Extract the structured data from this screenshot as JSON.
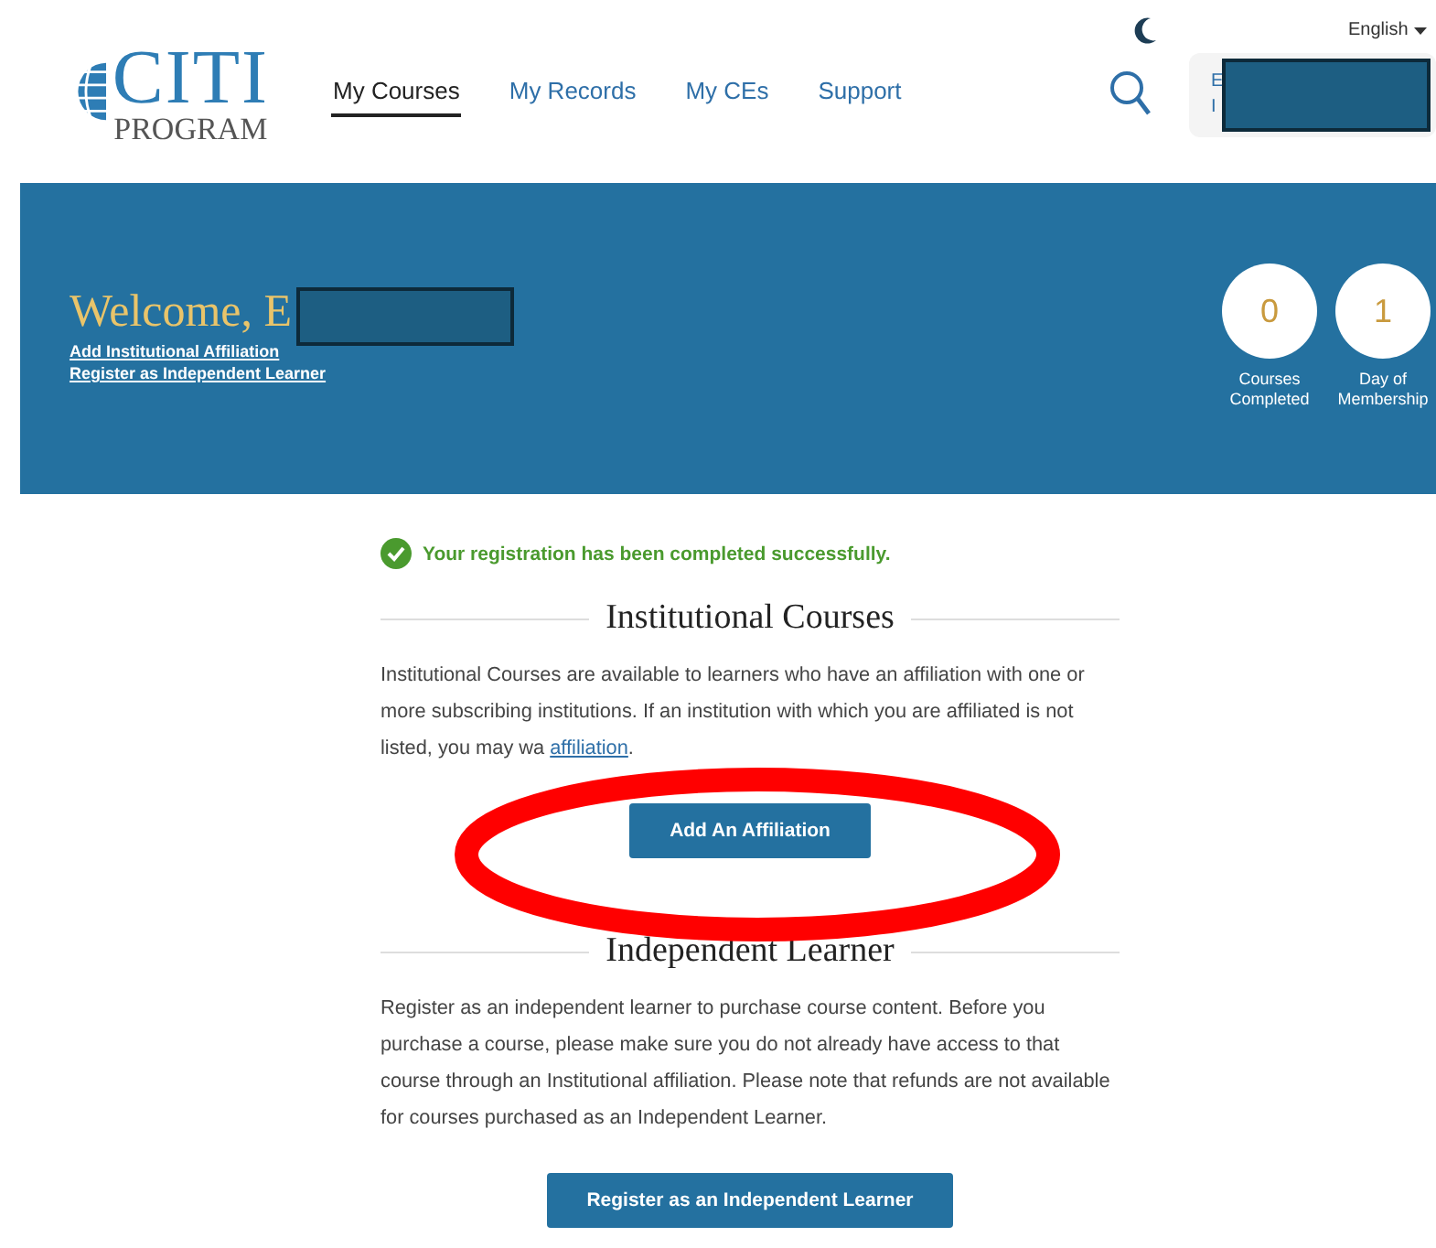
{
  "logo": {
    "title": "CITI",
    "subtitle": "PROGRAM"
  },
  "nav": [
    {
      "label": "My Courses",
      "selected": true
    },
    {
      "label": "My Records",
      "selected": false
    },
    {
      "label": "My CEs",
      "selected": false
    },
    {
      "label": "Support",
      "selected": false
    }
  ],
  "language": "English",
  "account": {
    "line_1": "E",
    "line_2": "I"
  },
  "banner": {
    "welcome": "Welcome, E",
    "links": [
      "Add Institutional Affiliation",
      "Register as Independent Learner"
    ],
    "stats": [
      {
        "value": "0",
        "label": "Courses Completed"
      },
      {
        "value": "1",
        "label": "Day of Membership"
      }
    ]
  },
  "success_message": "Your registration has been completed successfully.",
  "sections": [
    {
      "title": "Institutional Courses",
      "text": "Institutional Courses are available to learners who have an affiliation with one or more subscribing institutions. If an institution with which you are affiliated is not listed, you may wa",
      "link": "affiliation",
      "after": ".",
      "button": "Add An Affiliation"
    },
    {
      "title": "Independent Learner",
      "text": "Register as an independent learner to purchase course content. Before you purchase a course, please make sure you do not already have access to that course through an Institutional affiliation. Please note that refunds are not available for courses purchased as an Independent Learner.",
      "button": "Register as an Independent Learner"
    }
  ]
}
